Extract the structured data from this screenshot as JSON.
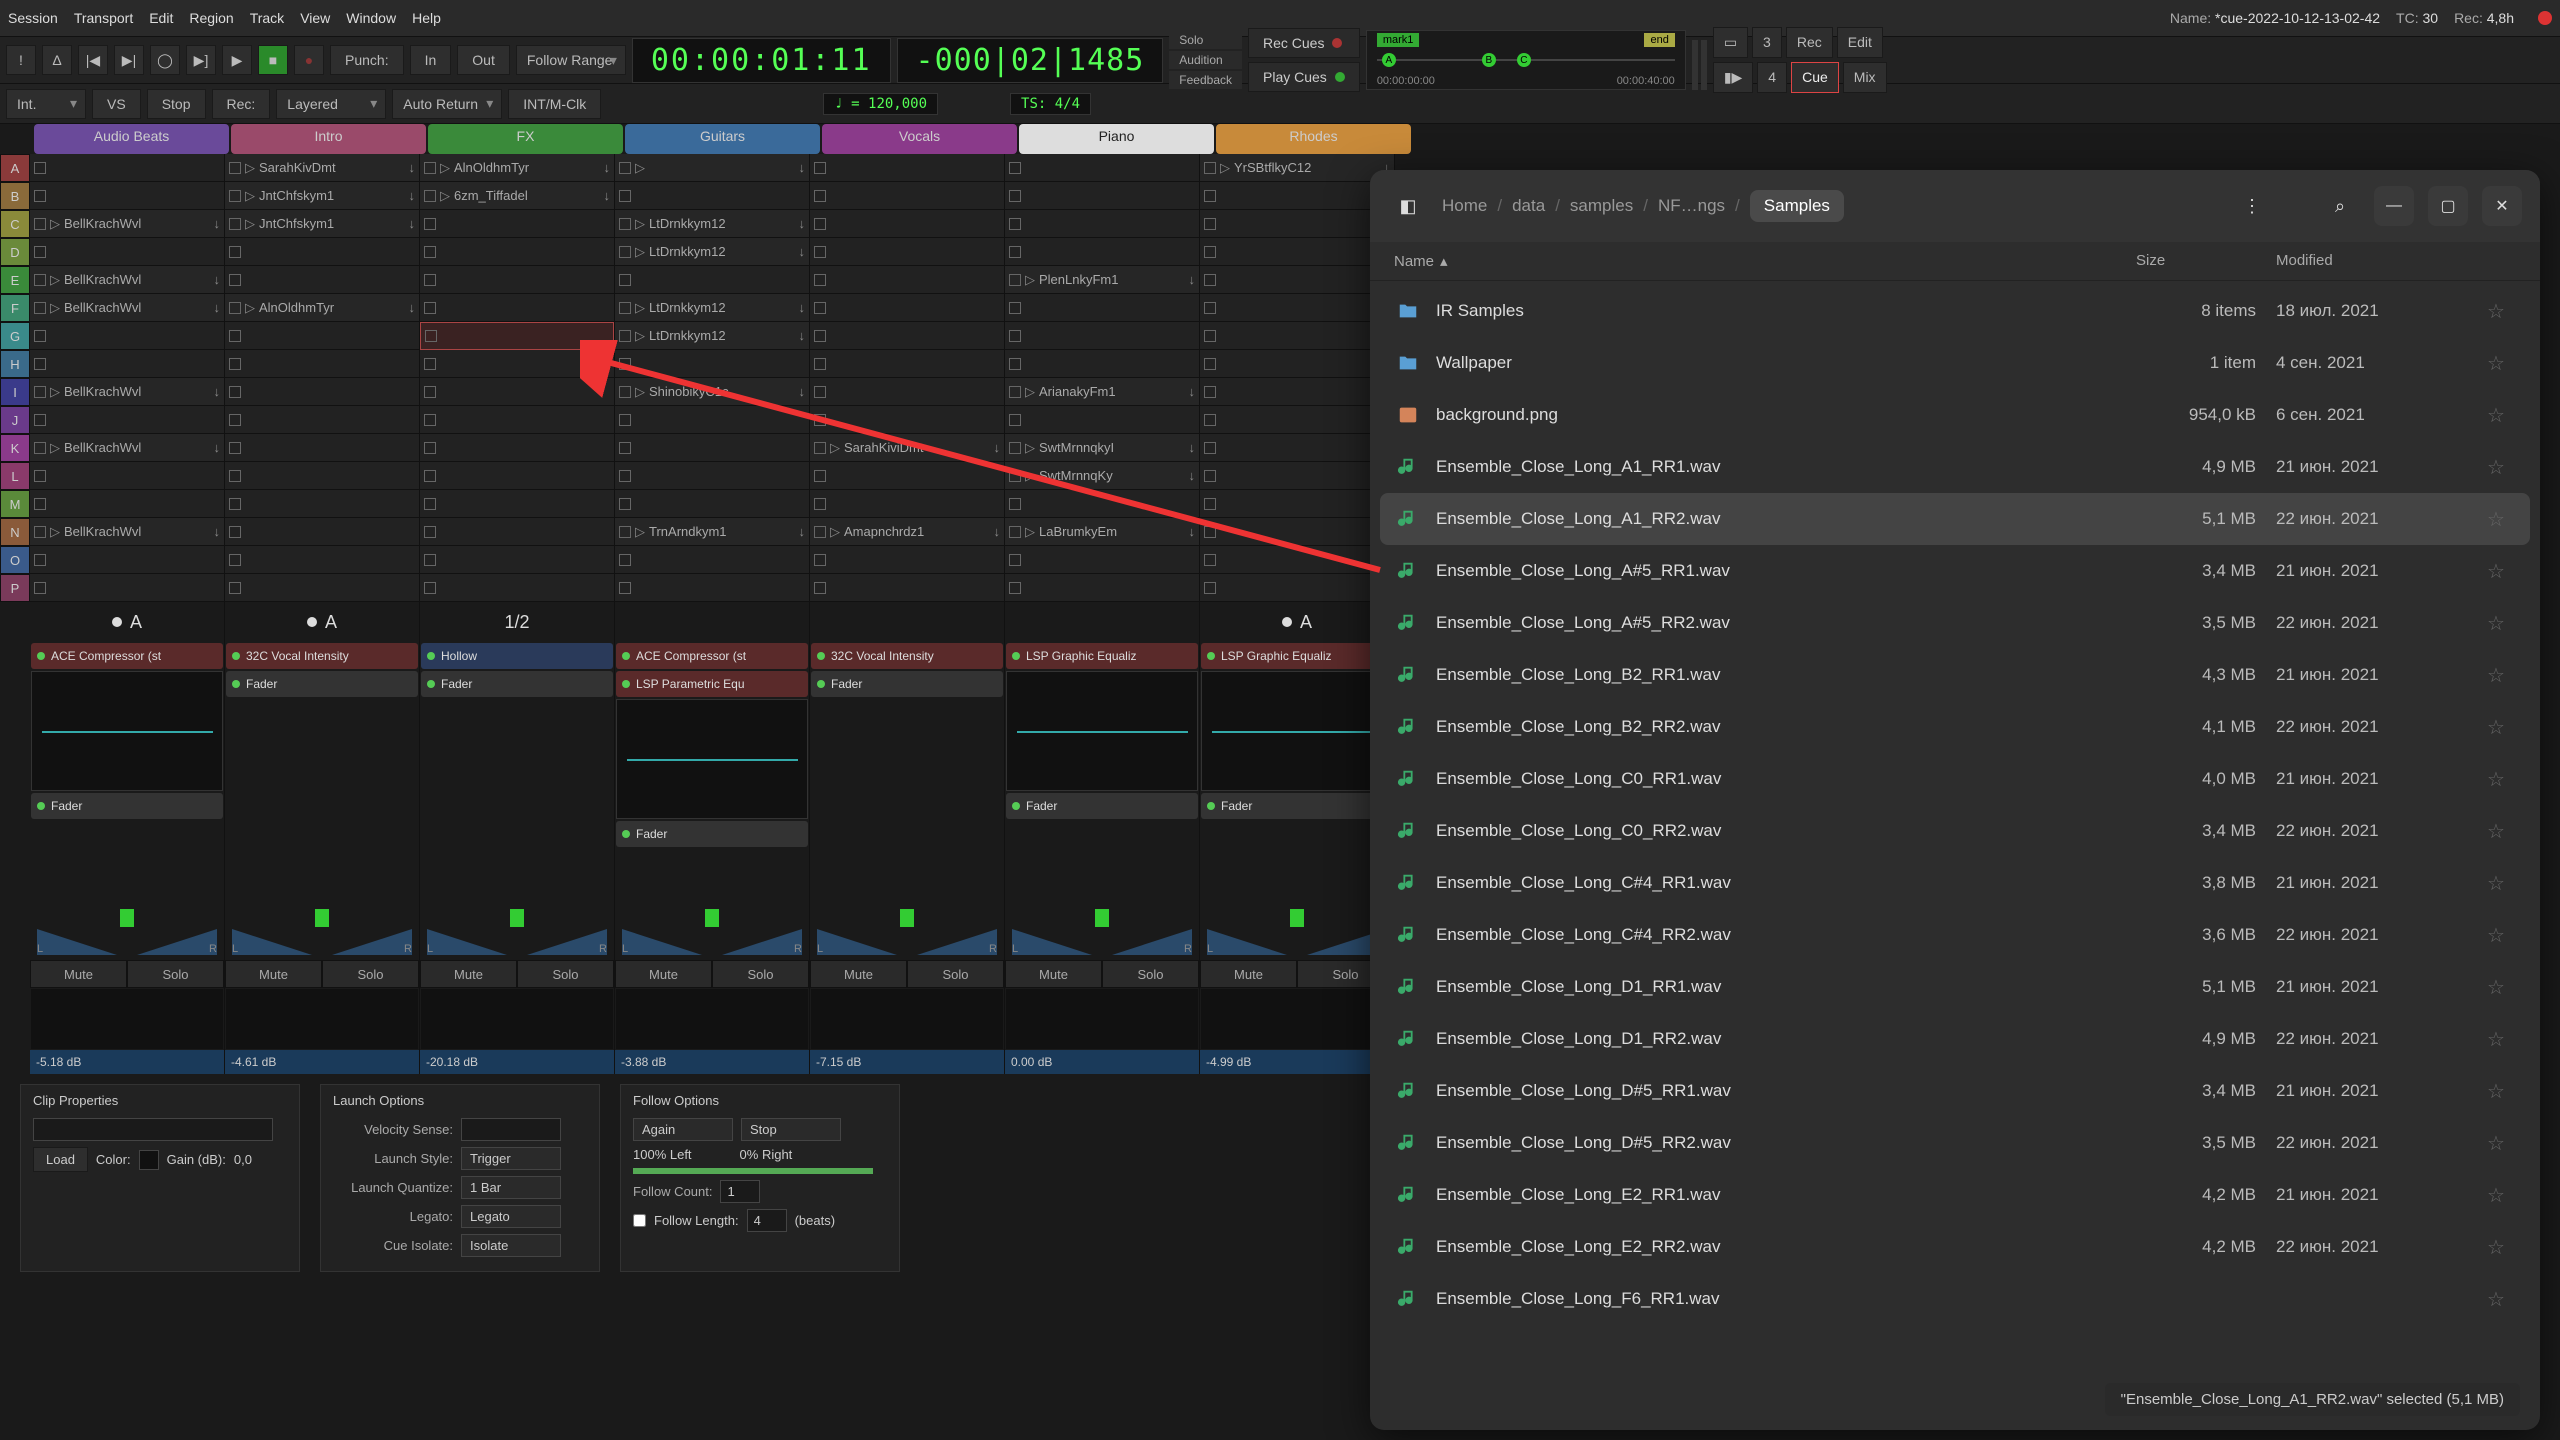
{
  "menu": [
    "Session",
    "Transport",
    "Edit",
    "Region",
    "Track",
    "View",
    "Window",
    "Help"
  ],
  "header": {
    "name_lbl": "Name:",
    "name": "*cue-2022-10-12-13-02-42",
    "tc_lbl": "TC:",
    "tc": "30",
    "rec_lbl": "Rec:",
    "rec": "4,8h"
  },
  "transport": {
    "punch": "Punch:",
    "in": "In",
    "out": "Out",
    "follow_range": "Follow Range",
    "clock1": "00:00:01:11",
    "clock2": "-000|02|1485",
    "tempo": "♩ = 120,000",
    "ts": "TS: 4/4",
    "solo": "Solo",
    "audition": "Audition",
    "feedback": "Feedback",
    "rec_cues": "Rec Cues",
    "play_cues": "Play Cues",
    "mark1": "mark1",
    "end": "end",
    "tA": "A",
    "tB": "B",
    "tC": "C",
    "t0": "00:00:00:00",
    "t1": "00:00:40:00",
    "n3": "3",
    "n4": "4",
    "rec_b": "Rec",
    "edit_b": "Edit",
    "cue_b": "Cue",
    "mix_b": "Mix"
  },
  "row2": {
    "int": "Int.",
    "vs": "VS",
    "stop": "Stop",
    "rec": "Rec:",
    "layered": "Layered",
    "auto_return": "Auto Return",
    "midi": "INT/M-Clk"
  },
  "cue_headers": [
    "Audio Beats",
    "Intro",
    "FX",
    "Guitars",
    "Vocals",
    "Piano",
    "Rhodes"
  ],
  "cue_letters": [
    "A",
    "B",
    "C",
    "D",
    "E",
    "F",
    "G",
    "H",
    "I",
    "J",
    "K",
    "L",
    "M",
    "N",
    "O",
    "P"
  ],
  "cues": {
    "c0": {
      "2": "BellKrachWvl",
      "4": "BellKrachWvl",
      "5": "BellKrachWvl",
      "8": "BellKrachWvl",
      "10": "BellKrachWvl",
      "13": "BellKrachWvl"
    },
    "c1": {
      "0": "SarahKivDmt",
      "1": "JntChfskym1",
      "2": "JntChfskym1",
      "5": "AlnOldhmTyr"
    },
    "c2": {
      "0": "AlnOldhmTyr",
      "1": "6zm_Tiffadel"
    },
    "c3": {
      "0": "",
      "2": "LtDrnkkym12",
      "3": "LtDrnkkym12",
      "5": "LtDrnkkym12",
      "6": "LtDrnkkym12",
      "8": "ShinobikyC1c",
      "13": "TrnArndkym1"
    },
    "c4": {
      "10": "SarahKiviDmt",
      "13": "Amapnchrdz1"
    },
    "c5": {
      "4": "PlenLnkyFm1",
      "8": "ArianakyFm1",
      "10": "SwtMrnnqkyI",
      "11": "SwtMrnnqKy",
      "13": "LaBrumkyEm"
    },
    "c6": {
      "0": "YrSBtflkyC12"
    }
  },
  "follow": {
    "c0": "A",
    "c1": "A",
    "c2": "1/2",
    "c6": "A"
  },
  "plugins": {
    "c0": [
      {
        "n": "ACE Compressor (st",
        "c": "red"
      },
      {
        "n": "",
        "c": "eq"
      },
      {
        "n": "Fader",
        "c": "gray"
      }
    ],
    "c1": [
      {
        "n": "32C Vocal Intensity",
        "c": "red"
      },
      {
        "n": "Fader",
        "c": "gray"
      }
    ],
    "c2": [
      {
        "n": "Hollow",
        "c": "blue"
      },
      {
        "n": "Fader",
        "c": "gray"
      }
    ],
    "c3": [
      {
        "n": "ACE Compressor (st",
        "c": "red"
      },
      {
        "n": "LSP Parametric Equ",
        "c": "red"
      },
      {
        "n": "",
        "c": "eq"
      },
      {
        "n": "Fader",
        "c": "gray"
      }
    ],
    "c4": [
      {
        "n": "32C Vocal Intensity",
        "c": "red"
      },
      {
        "n": "Fader",
        "c": "gray"
      }
    ],
    "c5": [
      {
        "n": "LSP Graphic Equaliz",
        "c": "red"
      },
      {
        "n": "",
        "c": "eq"
      },
      {
        "n": "Fader",
        "c": "gray"
      }
    ],
    "c6": [
      {
        "n": "LSP Graphic Equaliz",
        "c": "red"
      },
      {
        "n": "",
        "c": "eq"
      },
      {
        "n": "Fader",
        "c": "gray"
      }
    ]
  },
  "db": [
    "-5.18 dB",
    "-4.61 dB",
    "-20.18 dB",
    "-3.88 dB",
    "-7.15 dB",
    "0.00 dB",
    "-4.99 dB"
  ],
  "ms": {
    "mute": "Mute",
    "solo": "Solo",
    "L": "L",
    "R": "R"
  },
  "clip": {
    "title": "Clip Properties",
    "load": "Load",
    "color": "Color:",
    "gain": "Gain (dB):",
    "gain_v": "0,0"
  },
  "launch": {
    "title": "Launch Options",
    "vel": "Velocity Sense:",
    "style": "Launch Style:",
    "style_v": "Trigger",
    "quant": "Launch Quantize:",
    "quant_v": "1 Bar",
    "legato": "Legato:",
    "legato_v": "Legato",
    "iso": "Cue Isolate:",
    "iso_v": "Isolate"
  },
  "followopt": {
    "title": "Follow Options",
    "again": "Again",
    "stop": "Stop",
    "left": "100% Left",
    "right": "0% Right",
    "count": "Follow Count:",
    "count_v": "1",
    "len": "Follow Length:",
    "len_v": "4",
    "beats": "(beats)"
  },
  "fb": {
    "crumbs": [
      "Home",
      "data",
      "samples",
      "NF…ngs",
      "Samples"
    ],
    "cols": {
      "name": "Name",
      "size": "Size",
      "mod": "Modified"
    },
    "status": "\"Ensemble_Close_Long_A1_RR2.wav\" selected  (5,1 MB)",
    "files": [
      {
        "t": "folder",
        "n": "IR Samples",
        "s": "8 items",
        "m": "18 июл. 2021"
      },
      {
        "t": "folder",
        "n": "Wallpaper",
        "s": "1 item",
        "m": "4 сен. 2021"
      },
      {
        "t": "image",
        "n": "background.png",
        "s": "954,0 kB",
        "m": "6 сен. 2021"
      },
      {
        "t": "audio",
        "n": "Ensemble_Close_Long_A1_RR1.wav",
        "s": "4,9 MB",
        "m": "21 июн. 2021"
      },
      {
        "t": "audio",
        "n": "Ensemble_Close_Long_A1_RR2.wav",
        "s": "5,1 MB",
        "m": "22 июн. 2021",
        "sel": true
      },
      {
        "t": "audio",
        "n": "Ensemble_Close_Long_A#5_RR1.wav",
        "s": "3,4 MB",
        "m": "21 июн. 2021"
      },
      {
        "t": "audio",
        "n": "Ensemble_Close_Long_A#5_RR2.wav",
        "s": "3,5 MB",
        "m": "22 июн. 2021"
      },
      {
        "t": "audio",
        "n": "Ensemble_Close_Long_B2_RR1.wav",
        "s": "4,3 MB",
        "m": "21 июн. 2021"
      },
      {
        "t": "audio",
        "n": "Ensemble_Close_Long_B2_RR2.wav",
        "s": "4,1 MB",
        "m": "22 июн. 2021"
      },
      {
        "t": "audio",
        "n": "Ensemble_Close_Long_C0_RR1.wav",
        "s": "4,0 MB",
        "m": "21 июн. 2021"
      },
      {
        "t": "audio",
        "n": "Ensemble_Close_Long_C0_RR2.wav",
        "s": "3,4 MB",
        "m": "22 июн. 2021"
      },
      {
        "t": "audio",
        "n": "Ensemble_Close_Long_C#4_RR1.wav",
        "s": "3,8 MB",
        "m": "21 июн. 2021"
      },
      {
        "t": "audio",
        "n": "Ensemble_Close_Long_C#4_RR2.wav",
        "s": "3,6 MB",
        "m": "22 июн. 2021"
      },
      {
        "t": "audio",
        "n": "Ensemble_Close_Long_D1_RR1.wav",
        "s": "5,1 MB",
        "m": "21 июн. 2021"
      },
      {
        "t": "audio",
        "n": "Ensemble_Close_Long_D1_RR2.wav",
        "s": "4,9 MB",
        "m": "22 июн. 2021"
      },
      {
        "t": "audio",
        "n": "Ensemble_Close_Long_D#5_RR1.wav",
        "s": "3,4 MB",
        "m": "21 июн. 2021"
      },
      {
        "t": "audio",
        "n": "Ensemble_Close_Long_D#5_RR2.wav",
        "s": "3,5 MB",
        "m": "22 июн. 2021"
      },
      {
        "t": "audio",
        "n": "Ensemble_Close_Long_E2_RR1.wav",
        "s": "4,2 MB",
        "m": "21 июн. 2021"
      },
      {
        "t": "audio",
        "n": "Ensemble_Close_Long_E2_RR2.wav",
        "s": "4,2 MB",
        "m": "22 июн. 2021"
      },
      {
        "t": "audio",
        "n": "Ensemble_Close_Long_F6_RR1.wav",
        "s": "",
        "m": ""
      }
    ]
  }
}
